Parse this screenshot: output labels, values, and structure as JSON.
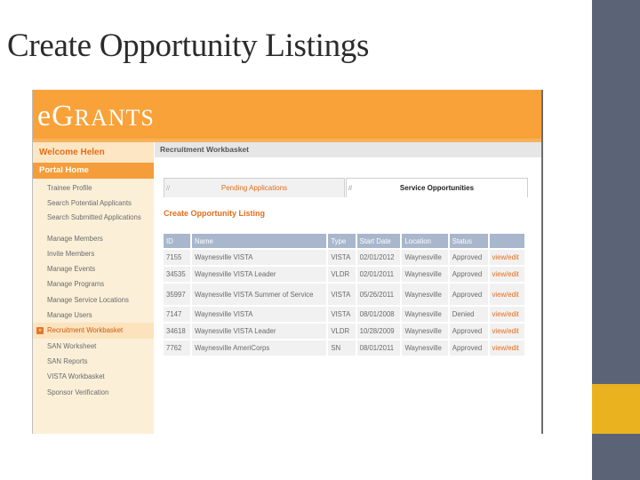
{
  "slide": {
    "title": "Create Opportunity Listings",
    "colors": {
      "band": "#5b6377",
      "accent_block": "#eab21f"
    }
  },
  "app": {
    "logo_e": "e",
    "logo_g": "G",
    "logo_rants": "RANTS",
    "colors": {
      "header": "#f9a23a",
      "link": "#e46d1a"
    }
  },
  "sidebar": {
    "welcome": "Welcome Helen",
    "portal_home": "Portal Home",
    "items": [
      {
        "label": "Trainee Profile"
      },
      {
        "label": "Search Potential Applicants"
      },
      {
        "label": "Search Submitted Applications"
      },
      {
        "label": "Manage Members"
      },
      {
        "label": "Invite Members"
      },
      {
        "label": "Manage Events"
      },
      {
        "label": "Manage Programs"
      },
      {
        "label": "Manage Service Locations"
      },
      {
        "label": "Manage Users"
      },
      {
        "label": "Recruitment Workbasket",
        "bullet": "»"
      },
      {
        "label": "SAN Worksheet"
      },
      {
        "label": "SAN Reports"
      },
      {
        "label": "VISTA Workbasket"
      },
      {
        "label": "Sponsor Verification"
      }
    ]
  },
  "main": {
    "title": "Recruitment Workbasket",
    "tabs": [
      {
        "label": "Pending Applications",
        "corner": "//"
      },
      {
        "label": "Service Opportunities",
        "corner": "//"
      }
    ],
    "section_title": "Create Opportunity Listing",
    "table": {
      "headers": [
        "ID",
        "Name",
        "Type",
        "Start Date",
        "Location",
        "Status",
        ""
      ],
      "rows": [
        [
          "7155",
          "Waynesville VISTA",
          "VISTA",
          "02/01/2012",
          "Waynesville",
          "Approved",
          "view/edit"
        ],
        [
          "34535",
          "Waynesville VISTA Leader",
          "VLDR",
          "02/01/2011",
          "Waynesville",
          "Approved",
          "view/edit"
        ],
        [
          "35997",
          "Waynesville VISTA Summer of Service",
          "VISTA",
          "05/26/2011",
          "Waynesville",
          "Approved",
          "view/edit"
        ],
        [
          "7147",
          "Waynesville VISTA",
          "VISTA",
          "08/01/2008",
          "Waynesville",
          "Denied",
          "view/edit"
        ],
        [
          "34618",
          "Waynesville VISTA Leader",
          "VLDR",
          "10/28/2009",
          "Waynesville",
          "Approved",
          "view/edit"
        ],
        [
          "7762",
          "Waynesville AmeriCorps",
          "SN",
          "08/01/2011",
          "Waynesville",
          "Approved",
          "view/edit"
        ]
      ]
    }
  }
}
